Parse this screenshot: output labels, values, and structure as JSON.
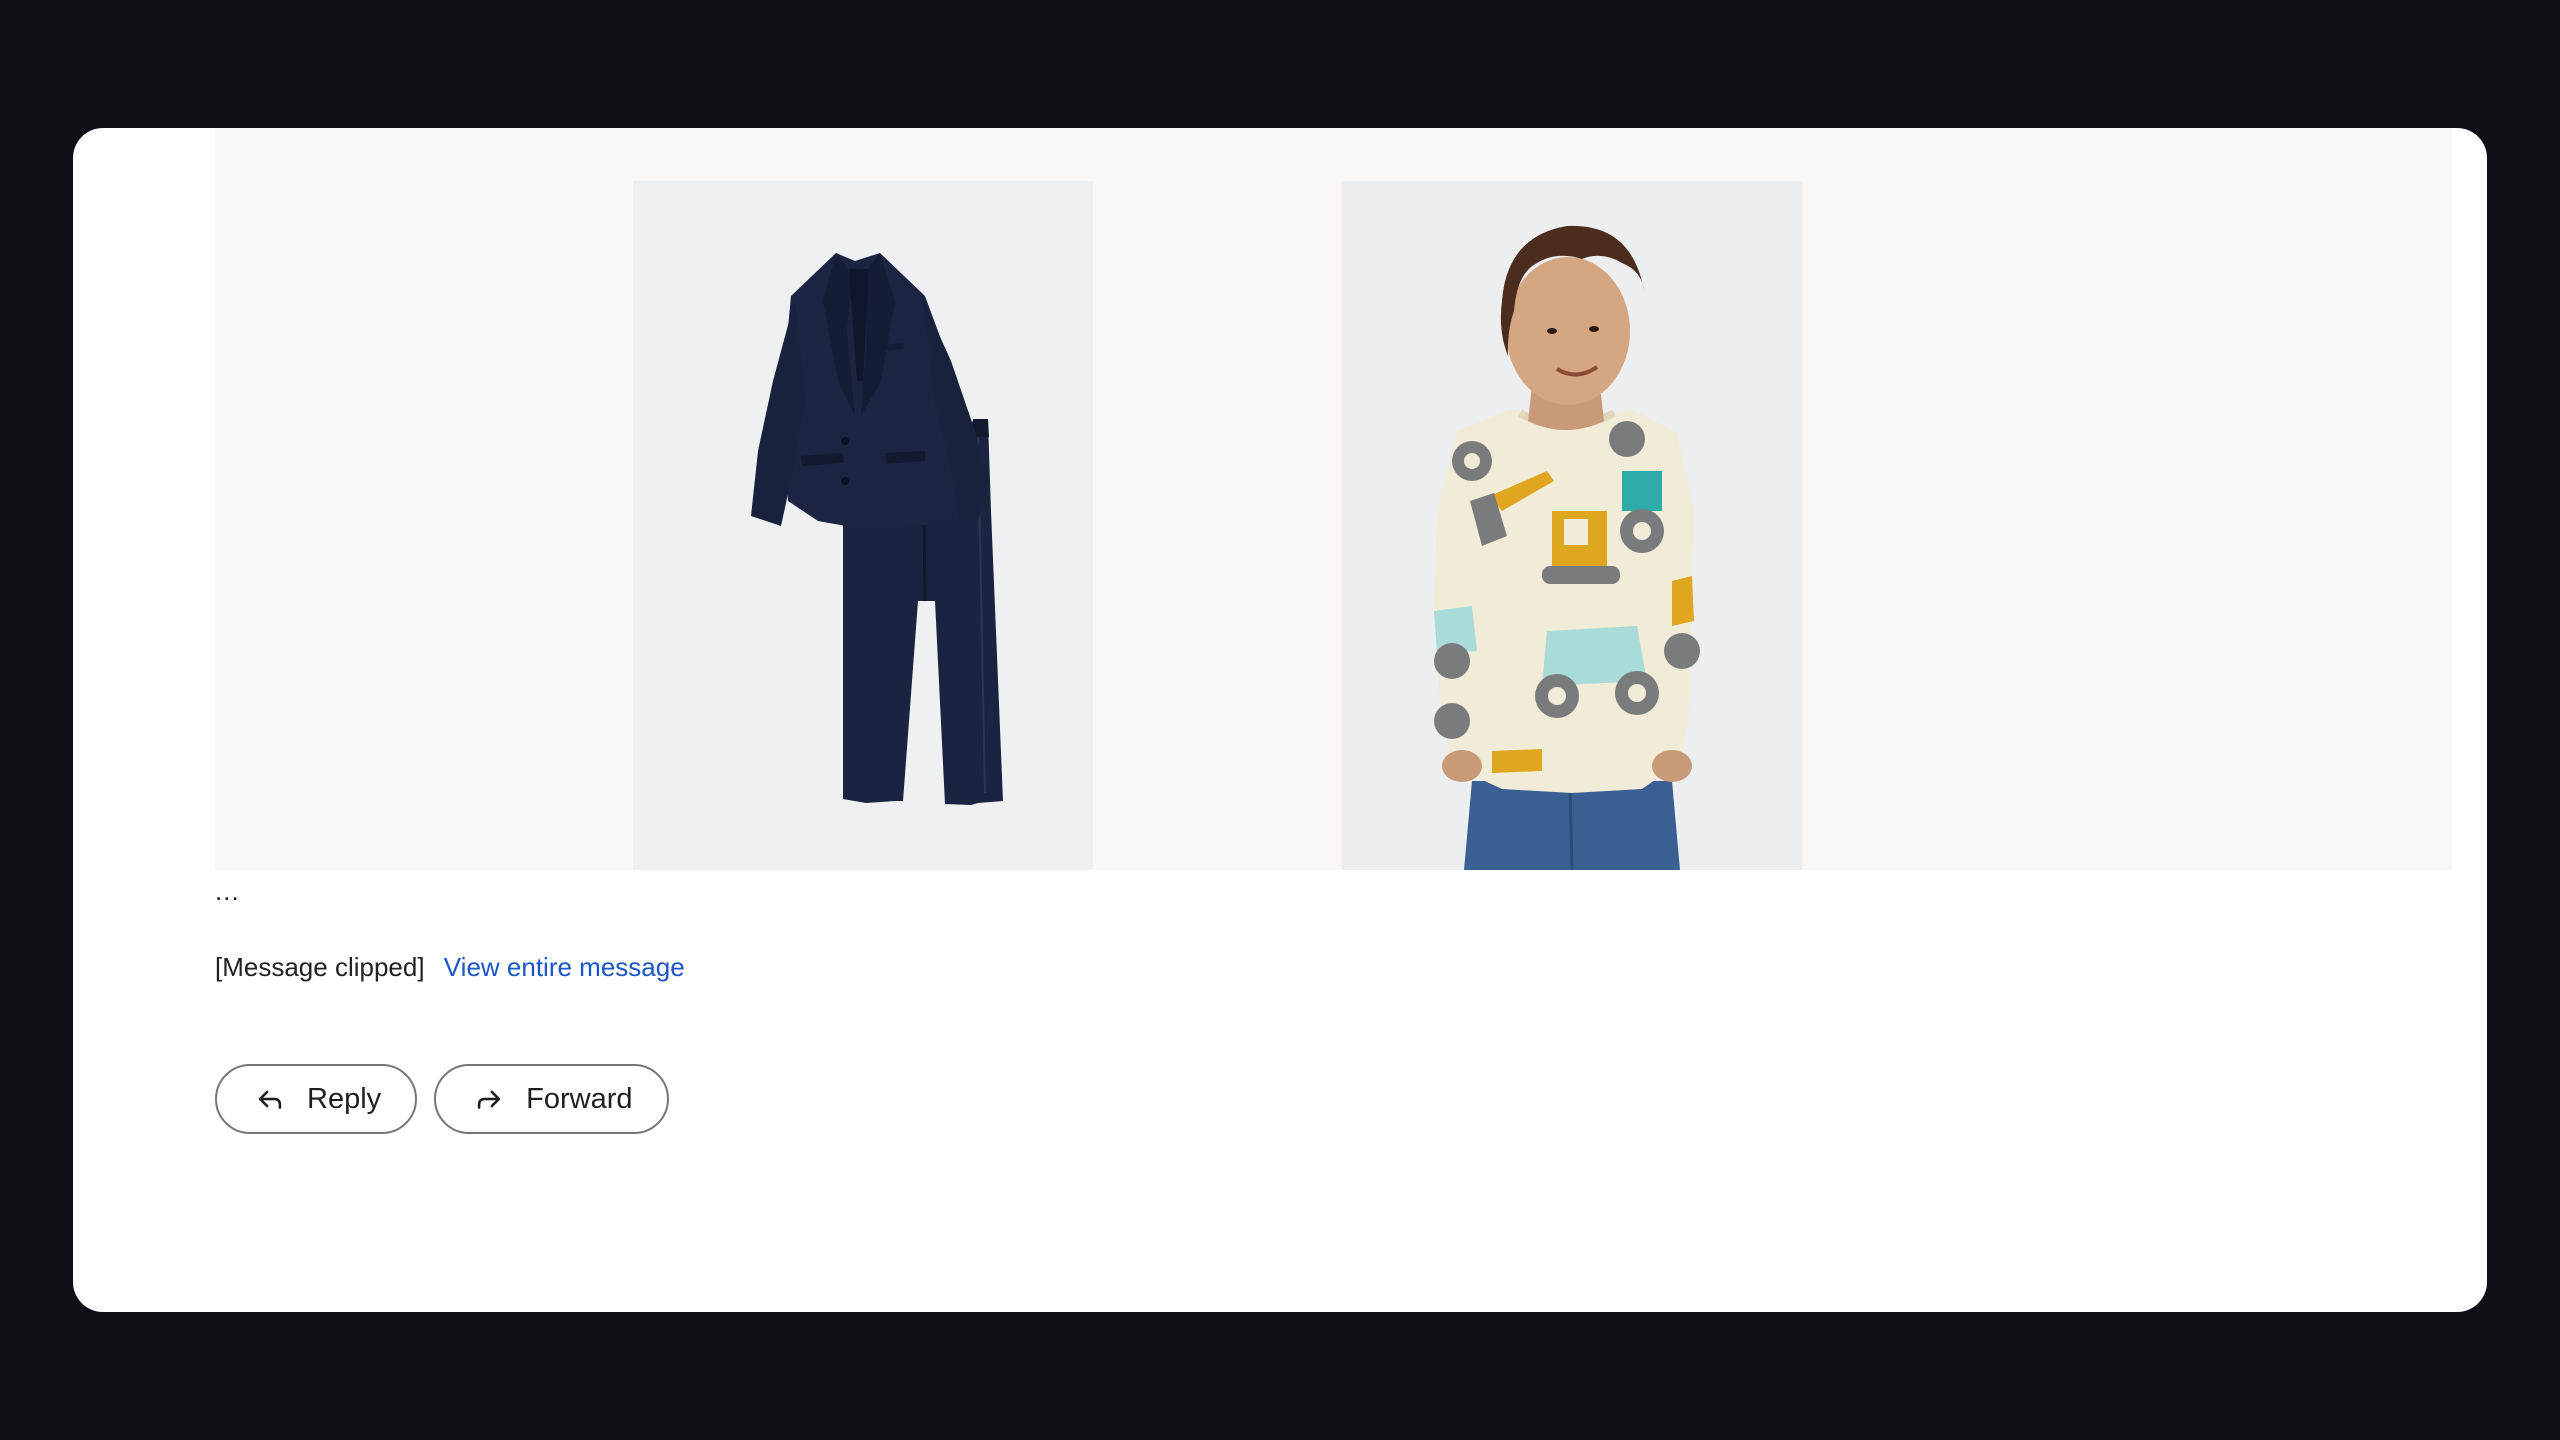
{
  "email": {
    "products": [
      {
        "name": "navy-suit-image"
      },
      {
        "name": "kid-construction-shirt-image"
      }
    ],
    "ellipsis": "...",
    "clipped_text": "[Message clipped]",
    "view_entire_label": "View entire message"
  },
  "actions": {
    "reply_label": "Reply",
    "reply_icon": "reply-arrow-icon",
    "forward_label": "Forward",
    "forward_icon": "forward-arrow-icon"
  },
  "colors": {
    "backdrop": "#0e1015",
    "link": "#1a56c8",
    "promo_bg": "#f9f8f6"
  }
}
